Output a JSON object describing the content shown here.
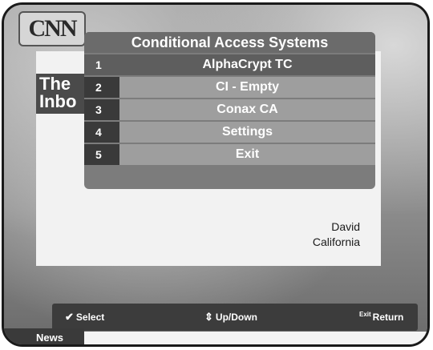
{
  "channel": {
    "logo": "CNN",
    "show_title_line1": "The",
    "show_title_line2": "Inbo",
    "caption_line1": "David",
    "caption_line2": "California",
    "ticker_label": "News"
  },
  "menu": {
    "title": "Conditional Access Systems",
    "items": [
      {
        "number": "1",
        "label": "AlphaCrypt TC",
        "selected": true
      },
      {
        "number": "2",
        "label": "CI - Empty",
        "selected": false
      },
      {
        "number": "3",
        "label": "Conax CA",
        "selected": false
      },
      {
        "number": "4",
        "label": "Settings",
        "selected": false
      },
      {
        "number": "5",
        "label": "Exit",
        "selected": false
      }
    ]
  },
  "help_bar": {
    "select_label": "Select",
    "updown_label": "Up/Down",
    "return_label": "Return",
    "exit_tag": "Exit"
  }
}
